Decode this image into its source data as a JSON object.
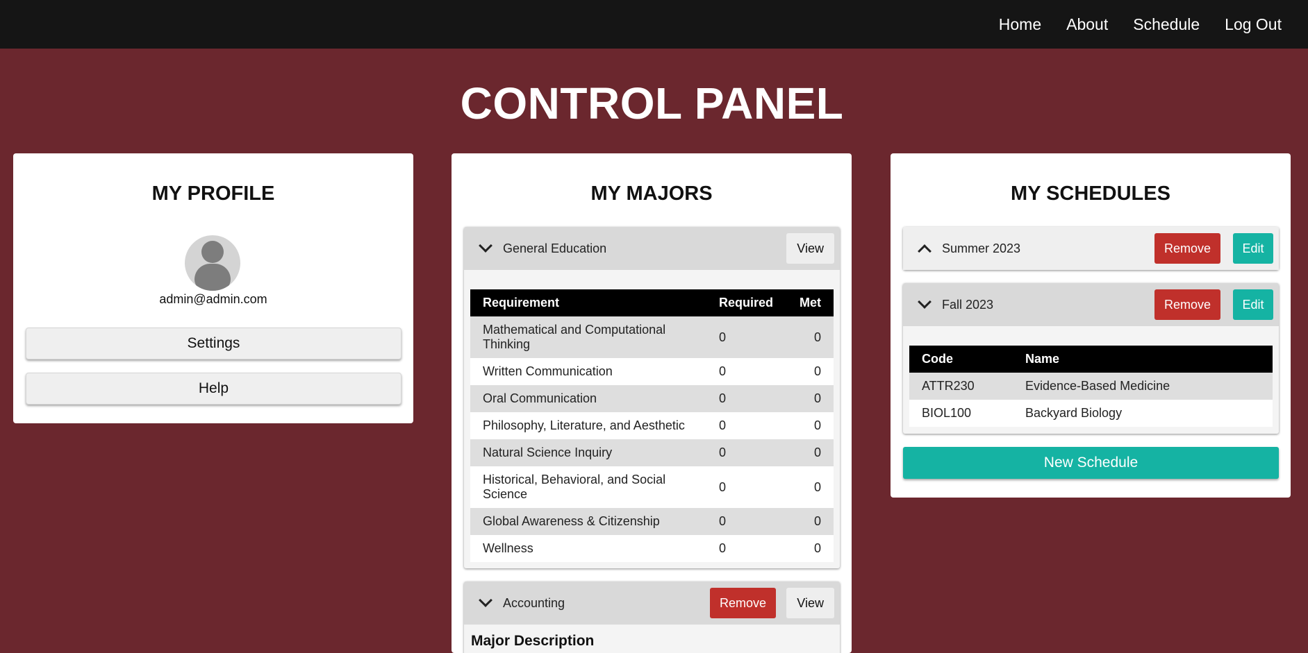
{
  "nav": {
    "home": "Home",
    "about": "About",
    "schedule": "Schedule",
    "logout": "Log Out"
  },
  "page_title": "CONTROL PANEL",
  "profile": {
    "title": "MY PROFILE",
    "email": "admin@admin.com",
    "settings_label": "Settings",
    "help_label": "Help"
  },
  "majors": {
    "title": "MY MAJORS",
    "items": [
      {
        "name": "General Education",
        "view_label": "View",
        "expanded": true,
        "columns": [
          "Requirement",
          "Required",
          "Met"
        ],
        "rows": [
          {
            "requirement": "Mathematical and Computational Thinking",
            "required": "0",
            "met": "0"
          },
          {
            "requirement": "Written Communication",
            "required": "0",
            "met": "0"
          },
          {
            "requirement": "Oral Communication",
            "required": "0",
            "met": "0"
          },
          {
            "requirement": "Philosophy, Literature, and Aesthetic",
            "required": "0",
            "met": "0"
          },
          {
            "requirement": "Natural Science Inquiry",
            "required": "0",
            "met": "0"
          },
          {
            "requirement": "Historical, Behavioral, and Social Science",
            "required": "0",
            "met": "0"
          },
          {
            "requirement": "Global Awareness & Citizenship",
            "required": "0",
            "met": "0"
          },
          {
            "requirement": "Wellness",
            "required": "0",
            "met": "0"
          }
        ]
      },
      {
        "name": "Accounting",
        "remove_label": "Remove",
        "view_label": "View",
        "expanded": true,
        "description_heading": "Major Description"
      }
    ]
  },
  "schedules": {
    "title": "MY SCHEDULES",
    "items": [
      {
        "name": "Summer 2023",
        "remove_label": "Remove",
        "edit_label": "Edit",
        "expanded": false
      },
      {
        "name": "Fall 2023",
        "remove_label": "Remove",
        "edit_label": "Edit",
        "expanded": true,
        "columns": [
          "Code",
          "Name"
        ],
        "courses": [
          {
            "code": "ATTR230",
            "name": "Evidence-Based Medicine"
          },
          {
            "code": "BIOL100",
            "name": "Backyard Biology"
          }
        ]
      }
    ],
    "new_label": "New Schedule"
  },
  "colors": {
    "page_bg": "#6b272e",
    "nav_bg": "#151515",
    "remove": "#c0302b",
    "accent": "#15b3a3"
  }
}
